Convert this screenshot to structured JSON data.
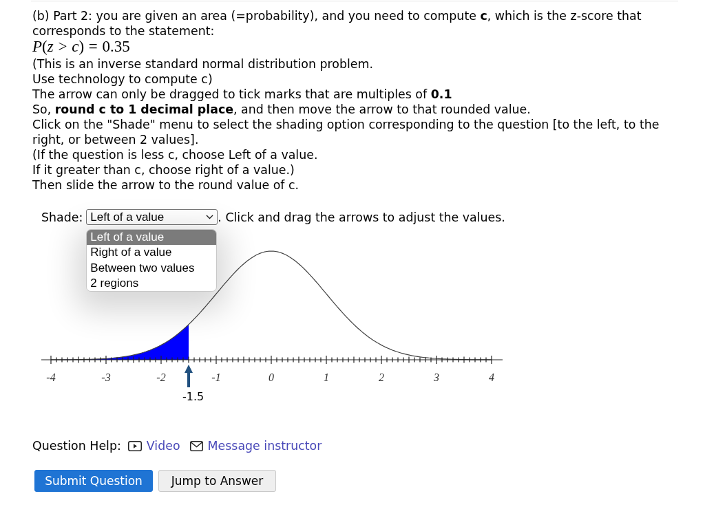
{
  "question": {
    "intro": "(b) Part 2: you are given an area (=probability), and you need to compute **c**, which is the z-score that corresponds to the statement:",
    "formula": "*P*(*z* > *c*) = 0.35",
    "lines": [
      "(This is an inverse standard normal distribution problem.",
      "Use technology to compute c)",
      "The arrow can only be dragged to tick marks that are multiples of **0.1**",
      "So, **round c to 1 decimal place**, and then move the arrow to that rounded value.",
      "Click on the \"Shade\" menu to select the shading option corresponding to the question [to the left, to the right, or between 2 values].",
      "(If the question is less c, choose Left of a value.",
      "If it greater than c, choose right of a value.)",
      "Then slide the arrow to the round value of c."
    ]
  },
  "shade": {
    "label": "Shade:",
    "value": "Left of a value",
    "expanded": true,
    "options": [
      {
        "label": "Left of a value",
        "selected": true
      },
      {
        "label": "Right of a value",
        "selected": false
      },
      {
        "label": "Between two values",
        "selected": false
      },
      {
        "label": "2 regions",
        "selected": false
      }
    ],
    "hint": ". Click and drag the arrows to adjust the values."
  },
  "graph": {
    "tick_labels": [
      "-4",
      "-3",
      "-2",
      "-1",
      "0",
      "1",
      "2",
      "3",
      "4"
    ],
    "arrow": {
      "level": 0.3125,
      "label": "-1.5"
    }
  },
  "question_help": {
    "label": "Question Help:",
    "links": [
      {
        "kind": "video",
        "label": "Video"
      },
      {
        "kind": "message",
        "label": "Message instructor"
      }
    ]
  },
  "buttons": [
    {
      "kind": "primary",
      "label": "Submit Question"
    },
    {
      "kind": "secondary",
      "label": "Jump to Answer"
    }
  ]
}
